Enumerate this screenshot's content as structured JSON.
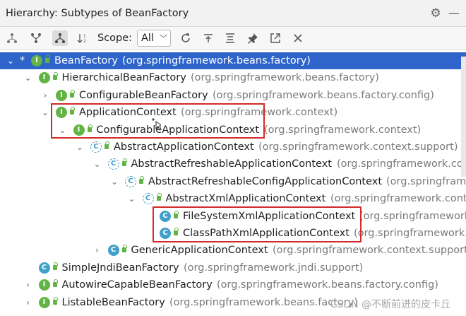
{
  "window": {
    "title": "Hierarchy:  Subtypes of BeanFactory",
    "settings_icon": "gear-icon",
    "minimize_icon": "minus-icon"
  },
  "toolbar": {
    "scope_label": "Scope:",
    "scope_value": "All",
    "buttons": [
      "supertypes-hierarchy-icon",
      "subtypes-hierarchy-icon",
      "class-hierarchy-icon",
      "sort-alphabetically-icon",
      "refresh-icon",
      "export-icon",
      "expand-all-icon",
      "pin-icon",
      "open-in-editor-icon",
      "close-icon"
    ]
  },
  "tree": [
    {
      "name": "BeanFactory",
      "pkg": "(org.springframework.beans.factory)",
      "kind": "interface",
      "star": "*",
      "selected": true
    },
    {
      "name": "HierarchicalBeanFactory",
      "pkg": "(org.springframework.beans.factory)",
      "kind": "interface"
    },
    {
      "name": "ConfigurableBeanFactory",
      "pkg": "(org.springframework.beans.factory.config)",
      "kind": "interface"
    },
    {
      "name": "ApplicationContext",
      "pkg": "(org.springframework.context)",
      "kind": "interface"
    },
    {
      "name": "ConfigurableApplicationContext",
      "pkg": "(org.springframework.context)",
      "kind": "interface"
    },
    {
      "name": "AbstractApplicationContext",
      "pkg": "(org.springframework.context.support)",
      "kind": "abstract"
    },
    {
      "name": "AbstractRefreshableApplicationContext",
      "pkg": "(org.springframework.context.support)",
      "kind": "abstract"
    },
    {
      "name": "AbstractRefreshableConfigApplicationContext",
      "pkg": "(org.springframework.context.support)",
      "kind": "abstract"
    },
    {
      "name": "AbstractXmlApplicationContext",
      "pkg": "(org.springframework.context.support)",
      "kind": "abstract"
    },
    {
      "name": "FileSystemXmlApplicationContext",
      "pkg": "(org.springframework.context.support)",
      "kind": "class"
    },
    {
      "name": "ClassPathXmlApplicationContext",
      "pkg": "(org.springframework.context.support)",
      "kind": "class"
    },
    {
      "name": "GenericApplicationContext",
      "pkg": "(org.springframework.context.support)",
      "kind": "class"
    },
    {
      "name": "SimpleJndiBeanFactory",
      "pkg": "(org.springframework.jndi.support)",
      "kind": "class"
    },
    {
      "name": "AutowireCapableBeanFactory",
      "pkg": "(org.springframework.beans.factory.config)",
      "kind": "interface"
    },
    {
      "name": "ListableBeanFactory",
      "pkg": "(org.springframework.beans.factory)",
      "kind": "interface"
    }
  ],
  "badge_letters": {
    "interface": "I",
    "class": "C",
    "abstract": "C"
  },
  "watermark": "CSDN @不断前进的皮卡丘",
  "colors": {
    "selection": "#2f65ca",
    "interface": "#62b543",
    "class": "#40a0c8",
    "highlight": "#d32a2a"
  }
}
